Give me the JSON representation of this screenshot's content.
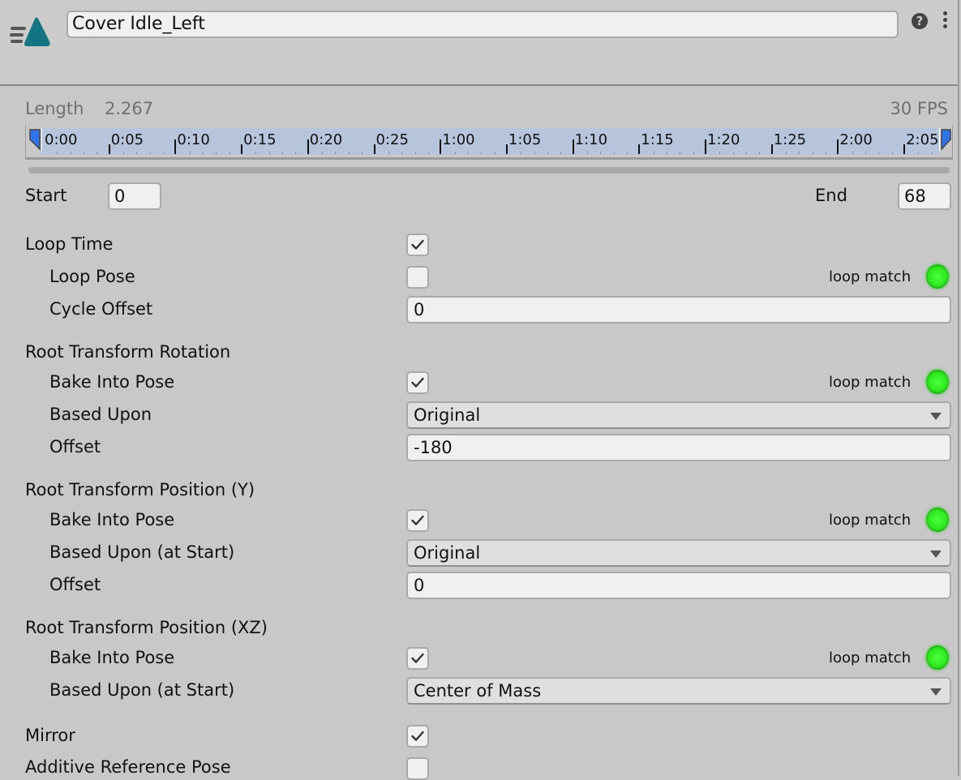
{
  "header": {
    "clip_name": "Cover Idle_Left",
    "icons": [
      "animation-clip-icon",
      "help-icon",
      "more-options-icon"
    ],
    "help_glyph": "?"
  },
  "clip_info": {
    "length_label": "Length",
    "length_value": "2.267",
    "fps": "30 FPS"
  },
  "timeline": {
    "ticks": [
      "0:00",
      "0:05",
      "0:10",
      "0:15",
      "0:20",
      "0:25",
      "1:00",
      "1:05",
      "1:10",
      "1:15",
      "1:20",
      "1:25",
      "2:00",
      "2:05"
    ]
  },
  "range": {
    "start_label": "Start",
    "start_value": "0",
    "end_label": "End",
    "end_value": "68"
  },
  "loop": {
    "loop_time_label": "Loop Time",
    "loop_time_checked": true,
    "loop_pose_label": "Loop Pose",
    "loop_pose_checked": false,
    "loop_match_label": "loop match",
    "cycle_offset_label": "Cycle Offset",
    "cycle_offset_value": "0"
  },
  "root_rotation": {
    "title": "Root Transform Rotation",
    "bake_label": "Bake Into Pose",
    "bake_checked": true,
    "loop_match_label": "loop match",
    "based_upon_label": "Based Upon",
    "based_upon_value": "Original",
    "offset_label": "Offset",
    "offset_value": "-180"
  },
  "root_position_y": {
    "title": "Root Transform Position (Y)",
    "bake_label": "Bake Into Pose",
    "bake_checked": true,
    "loop_match_label": "loop match",
    "based_upon_label": "Based Upon (at Start)",
    "based_upon_value": "Original",
    "offset_label": "Offset",
    "offset_value": "0"
  },
  "root_position_xz": {
    "title": "Root Transform Position (XZ)",
    "bake_label": "Bake Into Pose",
    "bake_checked": true,
    "loop_match_label": "loop match",
    "based_upon_label": "Based Upon (at Start)",
    "based_upon_value": "Center of Mass"
  },
  "mirror": {
    "label": "Mirror",
    "checked": true
  },
  "additive": {
    "label": "Additive Reference Pose",
    "checked": false
  },
  "colors": {
    "accent_teal": "#137582",
    "timeline_fill": "#b7c5dc",
    "loop_match_led": "#2ee81f"
  }
}
